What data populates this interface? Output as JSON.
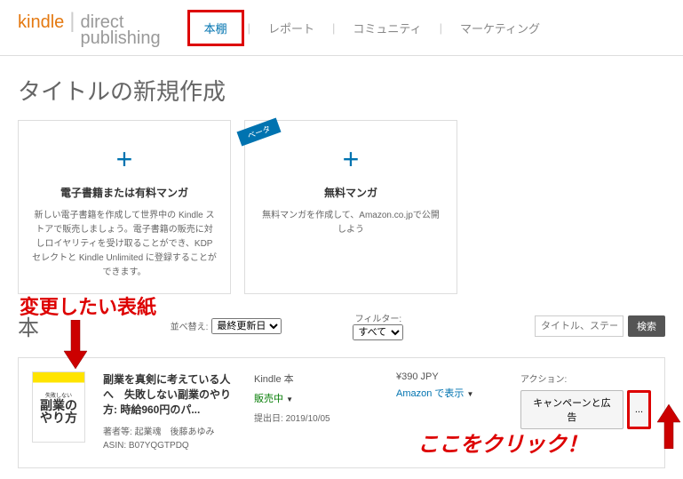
{
  "logo": {
    "kindle": "kindle",
    "dp1": "direct",
    "dp2": "publishing"
  },
  "nav": {
    "items": [
      "本棚",
      "レポート",
      "コミュニティ",
      "マーケティング"
    ],
    "active_index": 0
  },
  "section_title": "タイトルの新規作成",
  "cards": [
    {
      "title": "電子書籍または有料マンガ",
      "desc": "新しい電子書籍を作成して世界中の Kindle ストアで販売しましょう。電子書籍の販売に対しロイヤリティを受け取ることができ、KDP セレクトと Kindle Unlimited に登録することができます。"
    },
    {
      "badge": "ベータ",
      "title": "無料マンガ",
      "desc": "無料マンガを作成して、Amazon.co.jpで公開しよう"
    }
  ],
  "books_header": {
    "title": "本",
    "sort_label": "並べ替え:",
    "sort_value": "最終更新日",
    "filter_label": "フィルター:",
    "filter_value": "すべて",
    "search_placeholder": "タイトル、ステー",
    "search_icon": "🔍",
    "search_btn": "検索"
  },
  "book": {
    "cover": {
      "line1": "失敗しない",
      "big1": "副業の",
      "big2": "やり方"
    },
    "title": "副業を真剣に考えている人へ　失敗しない副業のやり方: 時給960円のパ...",
    "author_label": "著者等:",
    "authors": "起業魂　後藤あゆみ",
    "asin_label": "ASIN:",
    "asin": "B07YQGTPDQ",
    "format": "Kindle 本",
    "status": "販売中",
    "pub_label": "提出日:",
    "pub_date": "2019/10/05",
    "price": "¥390 JPY",
    "amazon_link": "Amazon で表示",
    "action_label": "アクション:",
    "campaign_btn": "キャンペーンと広告",
    "more": "..."
  },
  "annotations": {
    "change_cover": "変更したい表紙",
    "click_here": "ここをクリック！"
  }
}
